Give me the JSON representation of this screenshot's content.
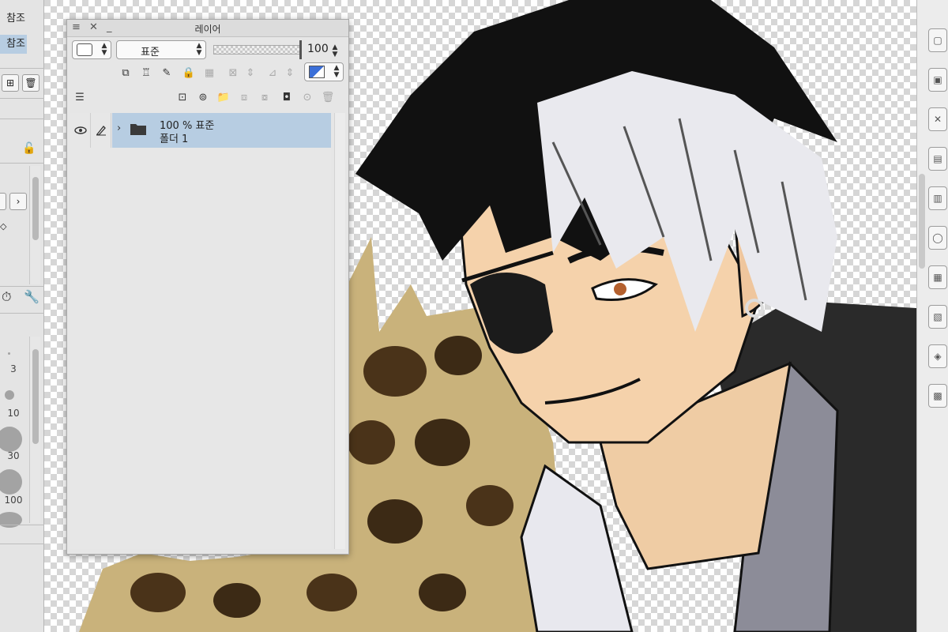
{
  "left_panel": {
    "ref_items": [
      "참조",
      "참조"
    ],
    "brush_sizes": [
      "3",
      "10",
      "30",
      "100"
    ]
  },
  "layer_panel": {
    "title": "레이어",
    "blend_mode": "표준",
    "opacity": "100",
    "layers": [
      {
        "mode": "100 % 표준",
        "name": "폴더 1",
        "type": "folder",
        "selected": true
      }
    ]
  },
  "colors": {
    "selection": "#b7cde2",
    "panel_bg": "#e6e6e6",
    "accent_blue": "#3b6fd8"
  }
}
